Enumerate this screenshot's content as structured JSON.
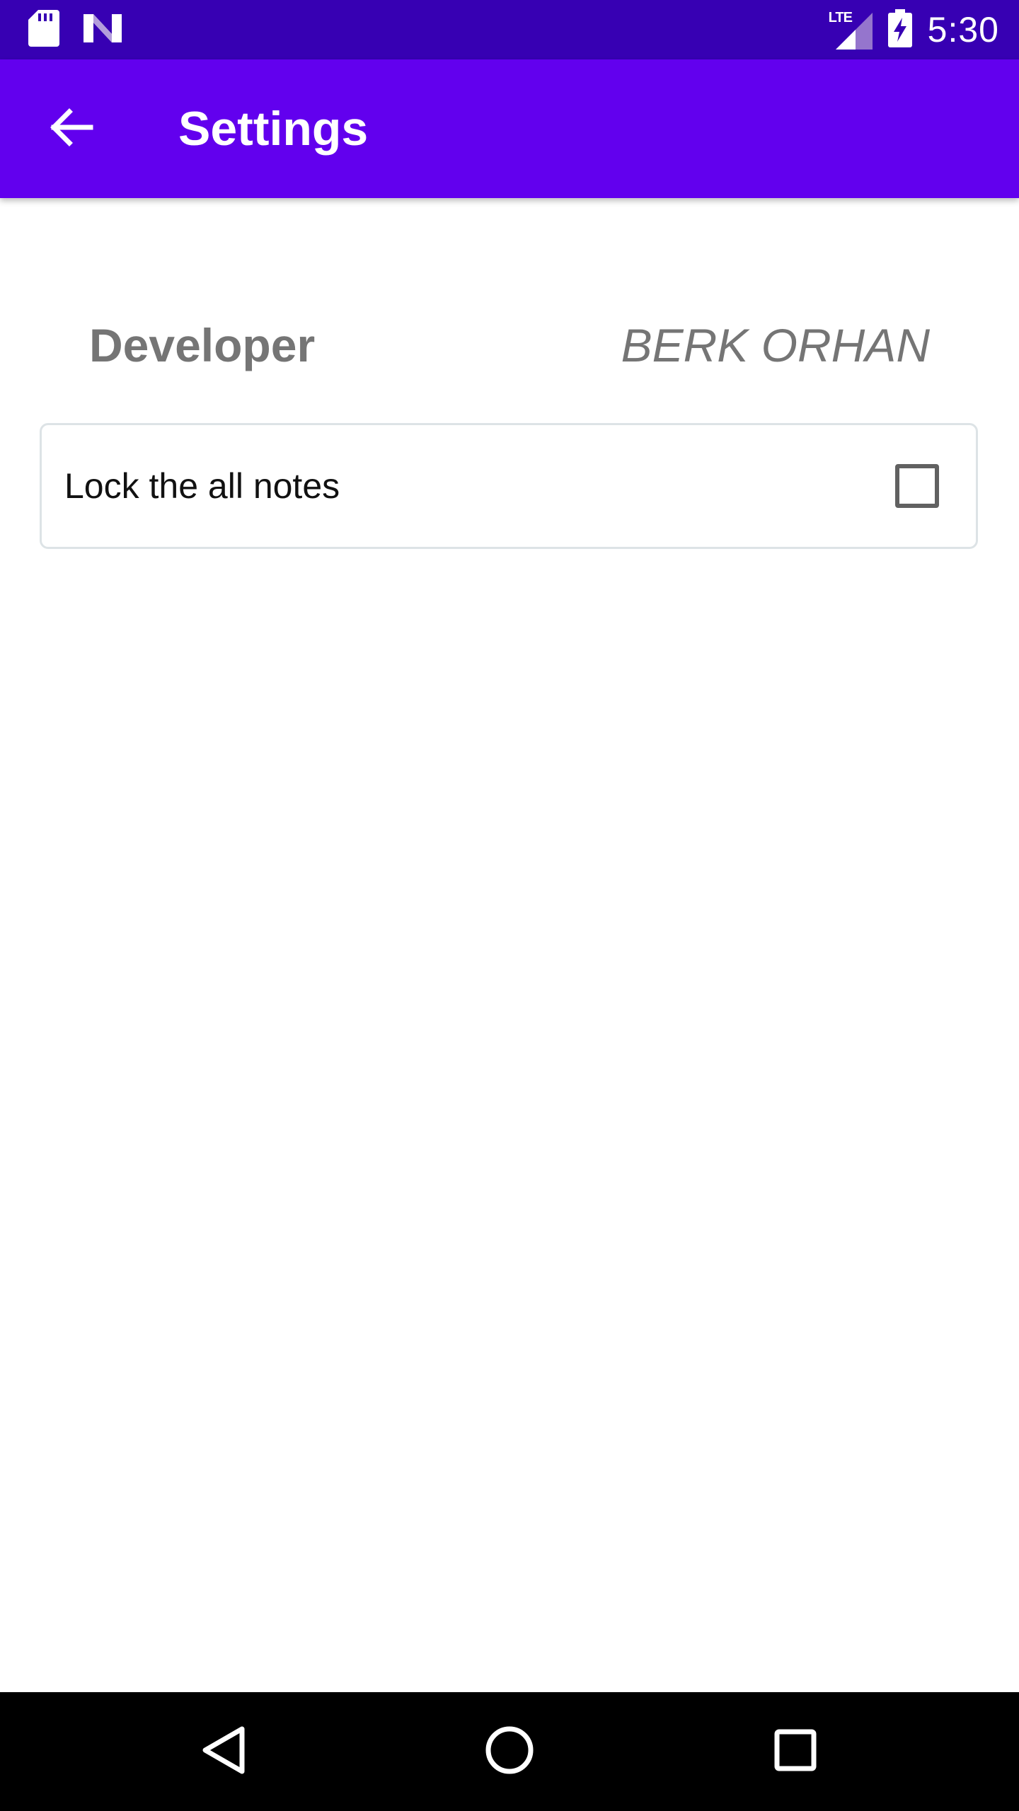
{
  "status_bar": {
    "time": "5:30",
    "network_label": "LTE",
    "icons": [
      "sd-card-icon",
      "app-notification-icon",
      "lte-signal-icon",
      "battery-charging-icon"
    ],
    "color": "#3700B3"
  },
  "app_bar": {
    "title": "Settings",
    "back_icon": "arrow-back-icon",
    "color": "#6200EE"
  },
  "developer": {
    "label": "Developer",
    "name": "BERK ORHAN"
  },
  "lock_setting": {
    "label": "Lock the all notes",
    "checked": false
  },
  "nav_bar": {
    "icons": [
      "back-triangle-icon",
      "home-circle-icon",
      "recents-square-icon"
    ]
  }
}
